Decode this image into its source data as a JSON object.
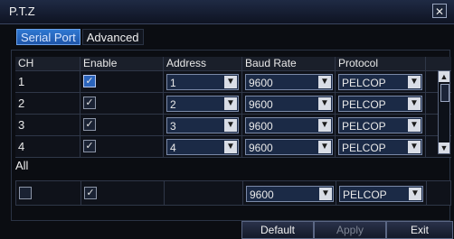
{
  "window": {
    "title": "P.T.Z",
    "close_glyph": "✕"
  },
  "tabs": [
    {
      "label": "Serial Port",
      "active": true
    },
    {
      "label": "Advanced",
      "active": false
    }
  ],
  "table": {
    "headers": [
      "CH",
      "Enable",
      "Address",
      "Baud Rate",
      "Protocol"
    ],
    "rows": [
      {
        "ch": "1",
        "enable": true,
        "address": "1",
        "baud_rate": "9600",
        "protocol": "PELCOP"
      },
      {
        "ch": "2",
        "enable": true,
        "address": "2",
        "baud_rate": "9600",
        "protocol": "PELCOP"
      },
      {
        "ch": "3",
        "enable": true,
        "address": "3",
        "baud_rate": "9600",
        "protocol": "PELCOP"
      },
      {
        "ch": "4",
        "enable": true,
        "address": "4",
        "baud_rate": "9600",
        "protocol": "PELCOP"
      }
    ]
  },
  "all": {
    "label": "All",
    "enable": true,
    "baud_rate": "9600",
    "protocol": "PELCOP"
  },
  "buttons": {
    "default": "Default",
    "apply": "Apply",
    "exit": "Exit"
  },
  "icons": {
    "dropdown_arrow": "chevron-down-icon",
    "checkmark": "checkmark-icon",
    "close": "close-icon"
  },
  "colors": {
    "accent": "#2b64bb",
    "background": "#0b0d12"
  }
}
